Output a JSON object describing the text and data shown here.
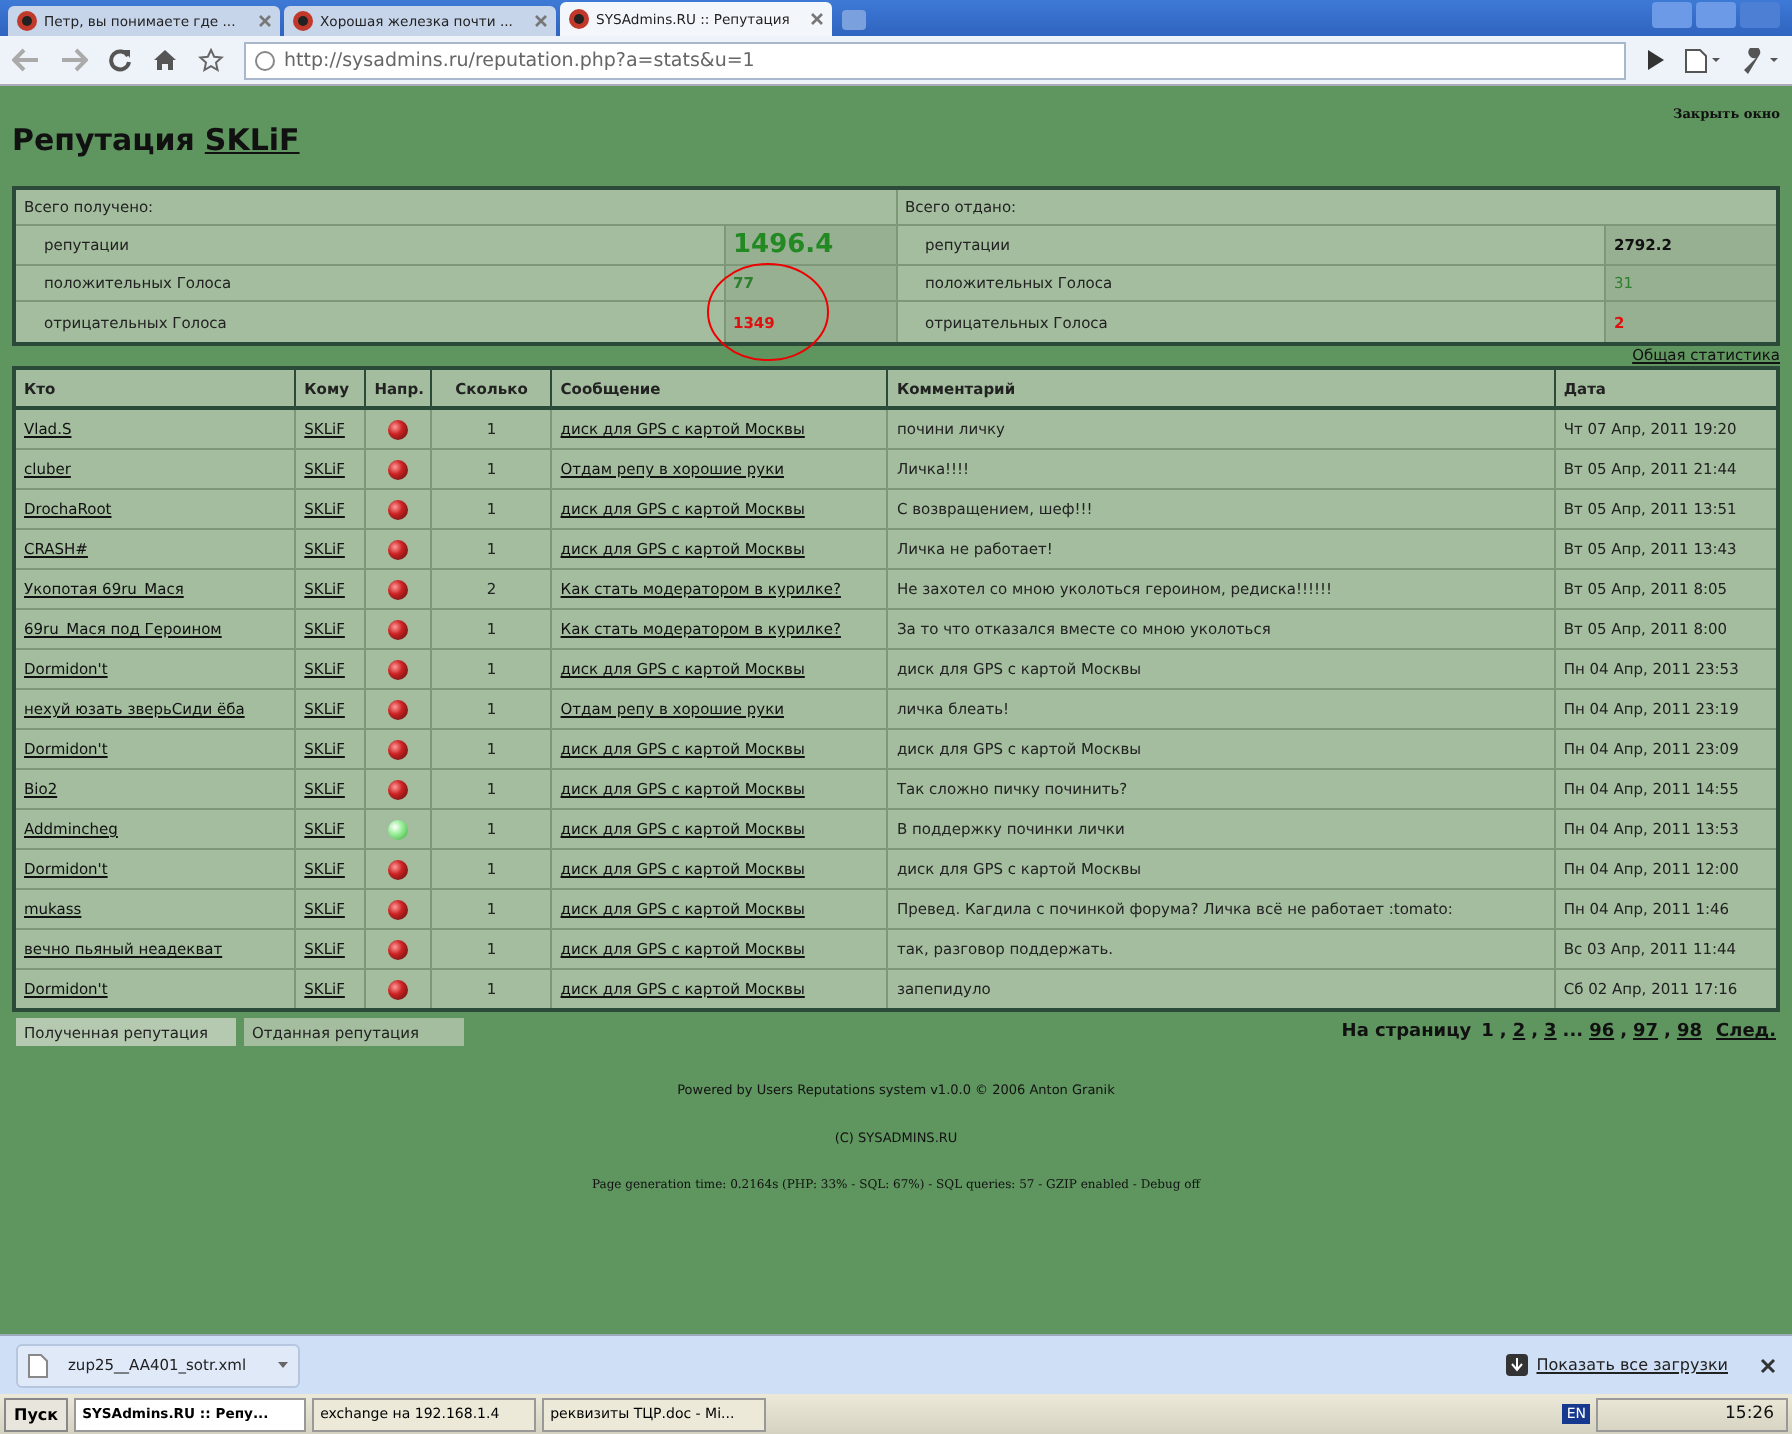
{
  "tabs": [
    {
      "label": "Петр, вы понимаете где ...",
      "selected": false
    },
    {
      "label": "Хорошая железка почти ...",
      "selected": false
    },
    {
      "label": "SYSAdmins.RU :: Репутация",
      "selected": true
    }
  ],
  "address": {
    "url": "http://sysadmins.ru/reputation.php?a=stats&u=1"
  },
  "page": {
    "title": "Репутация",
    "user": "SKLiF",
    "close": "Закрыть окно"
  },
  "stats": [
    {
      "heading": "Всего получено:",
      "rows": [
        {
          "kind": "reputation",
          "label": "репутации",
          "value": "1496.4"
        },
        {
          "kind": "positive",
          "label": "положительных Голоса",
          "value": "77"
        },
        {
          "kind": "negative",
          "label": "отрицательных Голоса",
          "value": "1349"
        }
      ]
    },
    {
      "heading": "Всего отдано:",
      "rows": [
        {
          "kind": "total",
          "label": "репутации",
          "value": "2792.2"
        },
        {
          "kind": "positive",
          "label": "положительных Голоса",
          "value": "31"
        },
        {
          "kind": "negative",
          "label": "отрицательных Голоса",
          "value": "2"
        }
      ]
    }
  ],
  "general_link": "Общая статистика",
  "table": {
    "columns": [
      "Кто",
      "Кому",
      "Напр.",
      "Сколько",
      "Сообщение",
      "Комментарий",
      "Дата"
    ],
    "rows": [
      {
        "who": "Vlad.S",
        "to": "SKLiF",
        "positive": false,
        "count": "1",
        "message": "диск для GPS с картой Москвы",
        "comment": "почини личку",
        "date": "Чт 07 Апр, 2011 19:20"
      },
      {
        "who": "cluber",
        "to": "SKLiF",
        "positive": false,
        "count": "1",
        "message": "Отдам репу в хорошие руки",
        "comment": "Личка!!!!",
        "date": "Вт 05 Апр, 2011 21:44"
      },
      {
        "who": "DrochaRoot",
        "to": "SKLiF",
        "positive": false,
        "count": "1",
        "message": "диск для GPS с картой Москвы",
        "comment": "С возвращением, шеф!!!",
        "date": "Вт 05 Апр, 2011 13:51"
      },
      {
        "who": "CRASH#",
        "to": "SKLiF",
        "positive": false,
        "count": "1",
        "message": "диск для GPS с картой Москвы",
        "comment": "Личка не работает!",
        "date": "Вт 05 Апр, 2011 13:43"
      },
      {
        "who": "Укопотая 69ru_Мася",
        "to": "SKLiF",
        "positive": false,
        "count": "2",
        "message": "Как стать модератором в курилке?",
        "comment": "Не захотел со мною уколоться героином, редиска!!!!!!",
        "date": "Вт 05 Апр, 2011 8:05"
      },
      {
        "who": "69ru_Мася под Героином",
        "to": "SKLiF",
        "positive": false,
        "count": "1",
        "message": "Как стать модератором в курилке?",
        "comment": "За то что отказался вместе со мною уколоться",
        "date": "Вт 05 Апр, 2011 8:00"
      },
      {
        "who": "Dormidon't",
        "to": "SKLiF",
        "positive": false,
        "count": "1",
        "message": "диск для GPS с картой Москвы",
        "comment": "диск для GPS с картой Москвы",
        "date": "Пн 04 Апр, 2011 23:53"
      },
      {
        "who": "нехуй юзать зверьСиди ёба",
        "to": "SKLiF",
        "positive": false,
        "count": "1",
        "message": "Отдам репу в хорошие руки",
        "comment": "личка блеать!",
        "date": "Пн 04 Апр, 2011 23:19"
      },
      {
        "who": "Dormidon't",
        "to": "SKLiF",
        "positive": false,
        "count": "1",
        "message": "диск для GPS с картой Москвы",
        "comment": "диск для GPS с картой Москвы",
        "date": "Пн 04 Апр, 2011 23:09"
      },
      {
        "who": "Bio2",
        "to": "SKLiF",
        "positive": false,
        "count": "1",
        "message": "диск для GPS с картой Москвы",
        "comment": "Так сложно пичку починить?",
        "date": "Пн 04 Апр, 2011 14:55"
      },
      {
        "who": "Addmincheg",
        "to": "SKLiF",
        "positive": true,
        "count": "1",
        "message": "диск для GPS с картой Москвы",
        "comment": "В поддержку починки лички",
        "date": "Пн 04 Апр, 2011 13:53"
      },
      {
        "who": "Dormidon't",
        "to": "SKLiF",
        "positive": false,
        "count": "1",
        "message": "диск для GPS с картой Москвы",
        "comment": "диск для GPS с картой Москвы",
        "date": "Пн 04 Апр, 2011 12:00"
      },
      {
        "who": "mukass",
        "to": "SKLiF",
        "positive": false,
        "count": "1",
        "message": "диск для GPS с картой Москвы",
        "comment": "Превед. Кагдила с починкой форума? Личка всё не работает :tomato:",
        "date": "Пн 04 Апр, 2011 1:46"
      },
      {
        "who": "вечно пьяный неадекват",
        "to": "SKLiF",
        "positive": false,
        "count": "1",
        "message": "диск для GPS с картой Москвы",
        "comment": "так, разговор поддержать.",
        "date": "Вс 03 Апр, 2011 11:44"
      },
      {
        "who": "Dormidon't",
        "to": "SKLiF",
        "positive": false,
        "count": "1",
        "message": "диск для GPS с картой Москвы",
        "comment": "запепидуло",
        "date": "Сб 02 Апр, 2011 17:16"
      }
    ]
  },
  "bottom_tabs": [
    {
      "label": "Полученная репутация",
      "selected": true
    },
    {
      "label": "Отданная репутация",
      "selected": false
    }
  ],
  "pagination": {
    "label": "На страницу",
    "separator": ",",
    "pages": [
      {
        "label": "1",
        "selected": true
      },
      {
        "label": "2",
        "selected": false
      },
      {
        "label": "3",
        "selected": false
      }
    ],
    "ellipsis": "...",
    "last_pages": [
      {
        "label": "96",
        "selected": false
      },
      {
        "label": "97",
        "selected": false
      },
      {
        "label": "98",
        "selected": false
      }
    ],
    "next": "След."
  },
  "footer": [
    "Powered by Users Reputations system v1.0.0 © 2006 Anton Granik",
    "(C) SYSADMINS.RU",
    "Page generation time: 0.2164s (PHP: 33% - SQL: 67%) - SQL queries: 57 - GZIP enabled - Debug off"
  ],
  "download": {
    "file": "zup25__AA401_sotr.xml",
    "show_all": "Показать все загрузки"
  },
  "taskbar": {
    "start": "Пуск",
    "tasks": [
      {
        "label": "SYSAdmins.RU :: Репу...",
        "selected": true
      },
      {
        "label": "exchange на 192.168.1.4",
        "selected": false
      },
      {
        "label": "реквизиты ТЦР.doc - Mi...",
        "selected": false
      }
    ],
    "lang": "EN",
    "clock": "15:26"
  }
}
